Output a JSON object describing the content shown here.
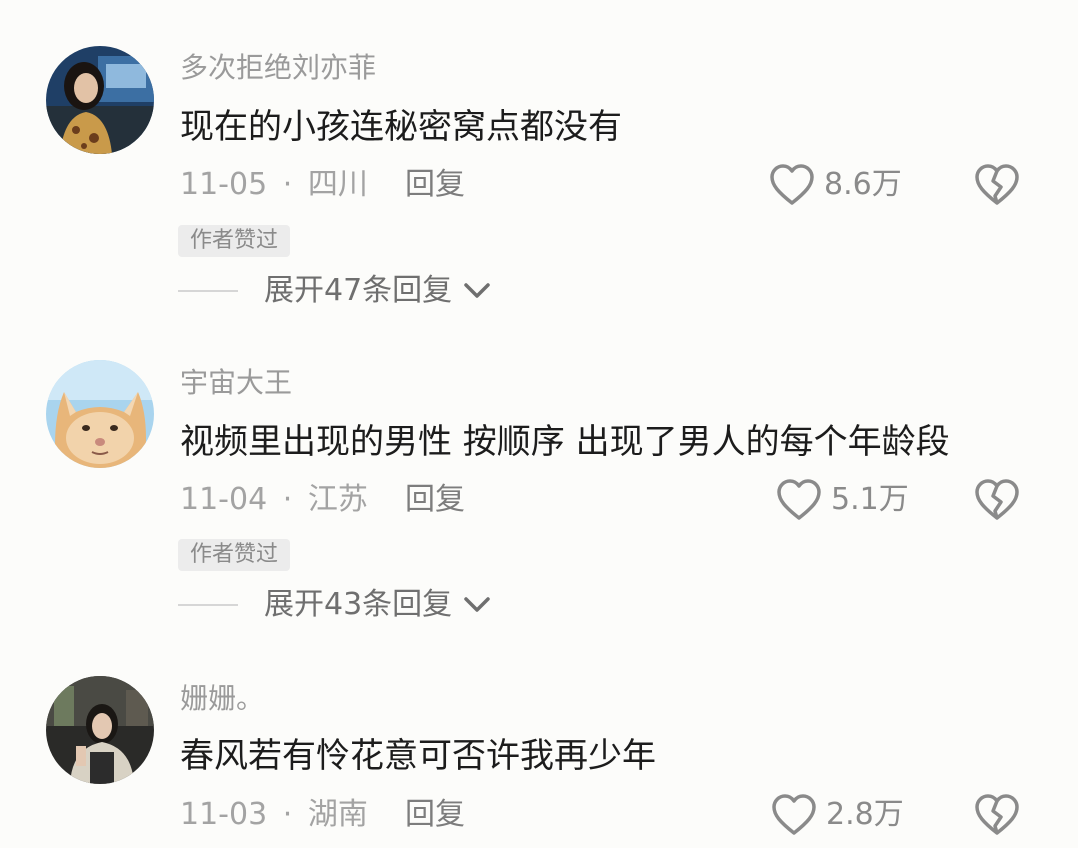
{
  "comments": [
    {
      "username": "多次拒绝刘亦菲",
      "text": "现在的小孩连秘密窝点都没有",
      "date": "11-05",
      "dot": "·",
      "location": "四川",
      "reply_label": "回复",
      "like_count": "8.6万",
      "badge": "作者赞过",
      "expand_label": "展开47条回复"
    },
    {
      "username": "宇宙大王",
      "text": "视频里出现的男性 按顺序 出现了男人的每个年龄段",
      "date": "11-04",
      "dot": "·",
      "location": "江苏",
      "reply_label": "回复",
      "like_count": "5.1万",
      "badge": "作者赞过",
      "expand_label": "展开43条回复"
    },
    {
      "username": "姗姗。",
      "text": "春风若有怜花意可否许我再少年",
      "date": "11-03",
      "dot": "·",
      "location": "湖南",
      "reply_label": "回复",
      "like_count": "2.8万"
    }
  ],
  "icons": {
    "like": "heart-outline-icon",
    "dislike": "broken-heart-icon",
    "expand": "chevron-down-icon"
  },
  "colors": {
    "background": "#fcfcfa",
    "username": "#9a9a9a",
    "text": "#1c1c1c",
    "meta": "#a3a3a3",
    "icon": "#8a8a8a"
  }
}
